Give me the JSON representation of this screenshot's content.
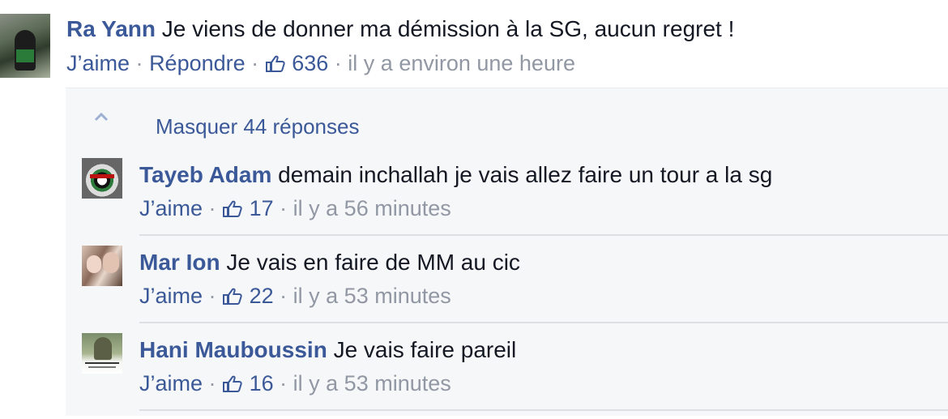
{
  "main_comment": {
    "author": "Ra Yann",
    "text": "Je viens de donner ma démission à la SG, aucun regret !",
    "like_label": "J’aime",
    "reply_label": "Répondre",
    "like_count": "636",
    "timestamp": "il y a environ une heure",
    "separator": "·"
  },
  "replies_panel": {
    "toggle_label": "Masquer 44 réponses",
    "items": [
      {
        "author": "Tayeb Adam",
        "text": "demain inchallah je vais allez faire un tour a la sg",
        "like_label": "J’aime",
        "like_count": "17",
        "timestamp": "il y a 56 minutes"
      },
      {
        "author": "Mar Ion",
        "text": "Je vais en faire de MM au cic",
        "like_label": "J’aime",
        "like_count": "22",
        "timestamp": "il y a 53 minutes"
      },
      {
        "author": "Hani Mauboussin",
        "text": "Je vais faire pareil",
        "like_label": "J’aime",
        "like_count": "16",
        "timestamp": "il y a 53 minutes"
      }
    ]
  },
  "colors": {
    "link": "#3b5998",
    "meta": "#9197a3",
    "text": "#141823",
    "panel_bg": "#f6f7f9"
  },
  "icons": {
    "like": "thumbs-up-icon",
    "toggle": "chevron-up-icon"
  }
}
